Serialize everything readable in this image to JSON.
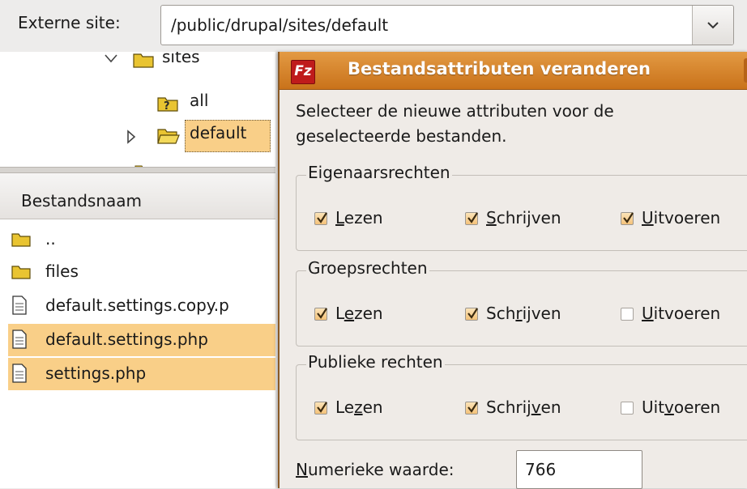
{
  "site_bar": {
    "label": "Externe site:",
    "path": "/public/drupal/sites/default"
  },
  "tree": {
    "items": [
      {
        "label": "sites",
        "icon": "folder-closed-icon"
      },
      {
        "label": "all",
        "icon": "folder-unknown-icon"
      },
      {
        "label": "default",
        "icon": "folder-open-icon",
        "selected": true
      }
    ]
  },
  "file_list": {
    "header": "Bestandsnaam",
    "rows": [
      {
        "name": "..",
        "icon": "folder-icon",
        "selected": false
      },
      {
        "name": "files",
        "icon": "folder-icon",
        "selected": false
      },
      {
        "name": "default.settings.copy.p",
        "icon": "document-icon",
        "selected": false
      },
      {
        "name": "default.settings.php",
        "icon": "document-icon",
        "selected": true
      },
      {
        "name": "settings.php",
        "icon": "document-icon",
        "selected": true
      }
    ]
  },
  "dialog": {
    "title": "Bestandsattributen veranderen",
    "logo": "Fz",
    "intro": "Selecteer de nieuwe attributen voor de geselecteerde bestanden.",
    "groups": [
      {
        "title": "Eigenaarsrechten",
        "options": [
          {
            "pre": "",
            "mn": "L",
            "post": "ezen",
            "checked": true
          },
          {
            "pre": "",
            "mn": "S",
            "post": "chrijven",
            "checked": true
          },
          {
            "pre": "",
            "mn": "U",
            "post": "itvoeren",
            "checked": true
          }
        ]
      },
      {
        "title": "Groepsrechten",
        "options": [
          {
            "pre": "L",
            "mn": "e",
            "post": "zen",
            "checked": true
          },
          {
            "pre": "Sch",
            "mn": "r",
            "post": "ijven",
            "checked": true
          },
          {
            "pre": "",
            "mn": "U",
            "post": "itvoeren",
            "checked": false
          }
        ]
      },
      {
        "title": "Publieke rechten",
        "options": [
          {
            "pre": "Le",
            "mn": "z",
            "post": "en",
            "checked": true
          },
          {
            "pre": "Schrij",
            "mn": "v",
            "post": "en",
            "checked": true
          },
          {
            "pre": "Uit",
            "mn": "v",
            "post": "oeren",
            "checked": false
          }
        ]
      }
    ],
    "numeric": {
      "mn": "N",
      "label_rest": "umerieke waarde:",
      "value": "766"
    }
  },
  "colors": {
    "selection": "#f9cf88",
    "titlebar": "#d9862f",
    "checkbox": "#f4c27a"
  }
}
